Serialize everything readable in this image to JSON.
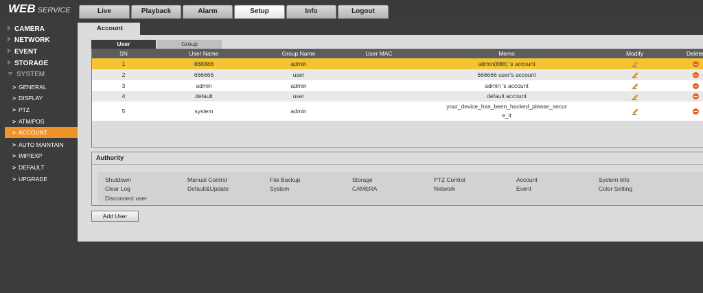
{
  "logo": {
    "web": "WEB",
    "service": "SERVICE"
  },
  "tabs": [
    {
      "label": "Live"
    },
    {
      "label": "Playback"
    },
    {
      "label": "Alarm"
    },
    {
      "label": "Setup"
    },
    {
      "label": "Info"
    },
    {
      "label": "Logout"
    }
  ],
  "active_tab": "Setup",
  "sidebar": {
    "top_items": [
      {
        "label": "CAMERA"
      },
      {
        "label": "NETWORK"
      },
      {
        "label": "EVENT"
      },
      {
        "label": "STORAGE"
      },
      {
        "label": "SYSTEM"
      }
    ],
    "system_items": [
      {
        "label": "GENERAL"
      },
      {
        "label": "DISPLAY"
      },
      {
        "label": "PTZ"
      },
      {
        "label": "ATM/POS"
      },
      {
        "label": "ACCOUNT"
      },
      {
        "label": "AUTO MAINTAIN"
      },
      {
        "label": "IMP/EXP"
      },
      {
        "label": "DEFAULT"
      },
      {
        "label": "UPGRADE"
      }
    ],
    "active_item": "ACCOUNT"
  },
  "page_tab": "Account",
  "sub_tabs": [
    {
      "label": "User"
    },
    {
      "label": "Group"
    }
  ],
  "active_sub_tab": "User",
  "table": {
    "headers": {
      "sn": "SN",
      "user_name": "User Name",
      "group_name": "Group Name",
      "user_mac": "User MAC",
      "memo": "Memo",
      "modify": "Modify",
      "delete": "Delete"
    },
    "rows": [
      {
        "sn": "1",
        "user_name": "888888",
        "group_name": "admin",
        "user_mac": "",
        "memo": "admin(888) 's account",
        "memo2": ""
      },
      {
        "sn": "2",
        "user_name": "666666",
        "group_name": "user",
        "user_mac": "",
        "memo": "666666 user's account",
        "memo2": ""
      },
      {
        "sn": "3",
        "user_name": "admin",
        "group_name": "admin",
        "user_mac": "",
        "memo": "admin 's account",
        "memo2": ""
      },
      {
        "sn": "4",
        "user_name": "default",
        "group_name": "user",
        "user_mac": "",
        "memo": "default account",
        "memo2": ""
      },
      {
        "sn": "5",
        "user_name": "system",
        "group_name": "admin",
        "user_mac": "",
        "memo": "your_device_has_been_hacked_please_secur",
        "memo2": "e_it"
      }
    ],
    "selected_row": 1
  },
  "authority": {
    "title": "Authority",
    "permissions": [
      "Shutdown",
      "Manual Control",
      "File Backup",
      "Storage",
      "PTZ Control",
      "Account",
      "System Info",
      "Clear Log",
      "Default&Update",
      "System",
      "CAMERA",
      "Network",
      "Event",
      "Color Setting",
      "Disconnect user"
    ]
  },
  "add_user_label": "Add User",
  "icons": {
    "modify": "pencil-icon",
    "delete": "delete-icon",
    "collapsed": "triangle-right-icon",
    "expanded": "triangle-down-icon",
    "subitem": "chevron-right-icon"
  },
  "colors": {
    "accent": "#f0932b",
    "selected_row": "#f4c531",
    "header": "#5d5d5d",
    "background": "#3c3c3c",
    "panel": "#dcdcdc"
  }
}
